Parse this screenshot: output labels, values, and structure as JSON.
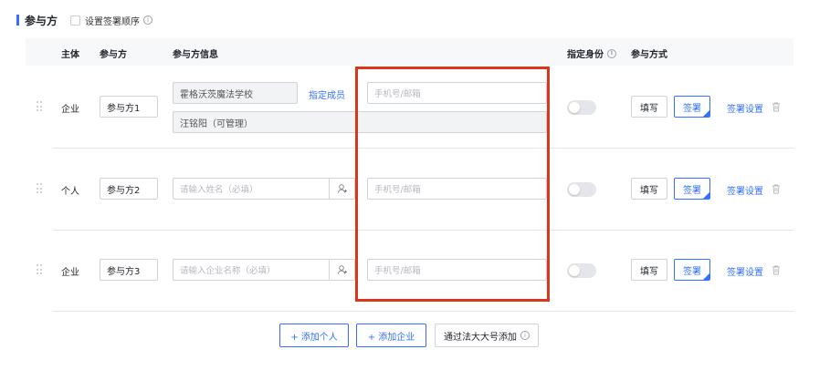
{
  "header": {
    "title": "参与方",
    "set_order_label": "设置签署顺序",
    "info_glyph": "i"
  },
  "table": {
    "columns": {
      "subject": "主体",
      "party": "参与方",
      "party_info": "参与方信息",
      "identity": "指定身份",
      "mode": "参与方式"
    }
  },
  "rows": [
    {
      "subject": "企业",
      "party_name": "参与方1",
      "org_name": "霍格沃茨魔法学校",
      "assign_member_label": "指定成员",
      "member": "汪铭阳（可管理）",
      "contact_placeholder": "手机号/邮箱",
      "identity_enabled": false,
      "fill_label": "填写",
      "sign_label": "签署",
      "sign_setting_label": "签署设置"
    },
    {
      "subject": "个人",
      "party_name": "参与方2",
      "name_placeholder": "请输入姓名（必填）",
      "contact_placeholder": "手机号/邮箱",
      "identity_enabled": false,
      "fill_label": "填写",
      "sign_label": "签署",
      "sign_setting_label": "签署设置"
    },
    {
      "subject": "企业",
      "party_name": "参与方3",
      "name_placeholder": "请输入企业名称（必填）",
      "contact_placeholder": "手机号/邮箱",
      "identity_enabled": false,
      "fill_label": "填写",
      "sign_label": "签署",
      "sign_setting_label": "签署设置"
    }
  ],
  "footer": {
    "add_person": "+ 添加个人",
    "add_company": "+ 添加企业",
    "add_by_legal": "通过法大大号添加",
    "info_glyph": "i"
  },
  "colors": {
    "accent": "#3370ff",
    "highlight": "#d9361c",
    "border": "#d0d3d9"
  },
  "icons": {
    "user_add": "user-add-icon",
    "trash": "trash-icon",
    "drag": "drag-handle-icon",
    "info": "info-icon"
  }
}
